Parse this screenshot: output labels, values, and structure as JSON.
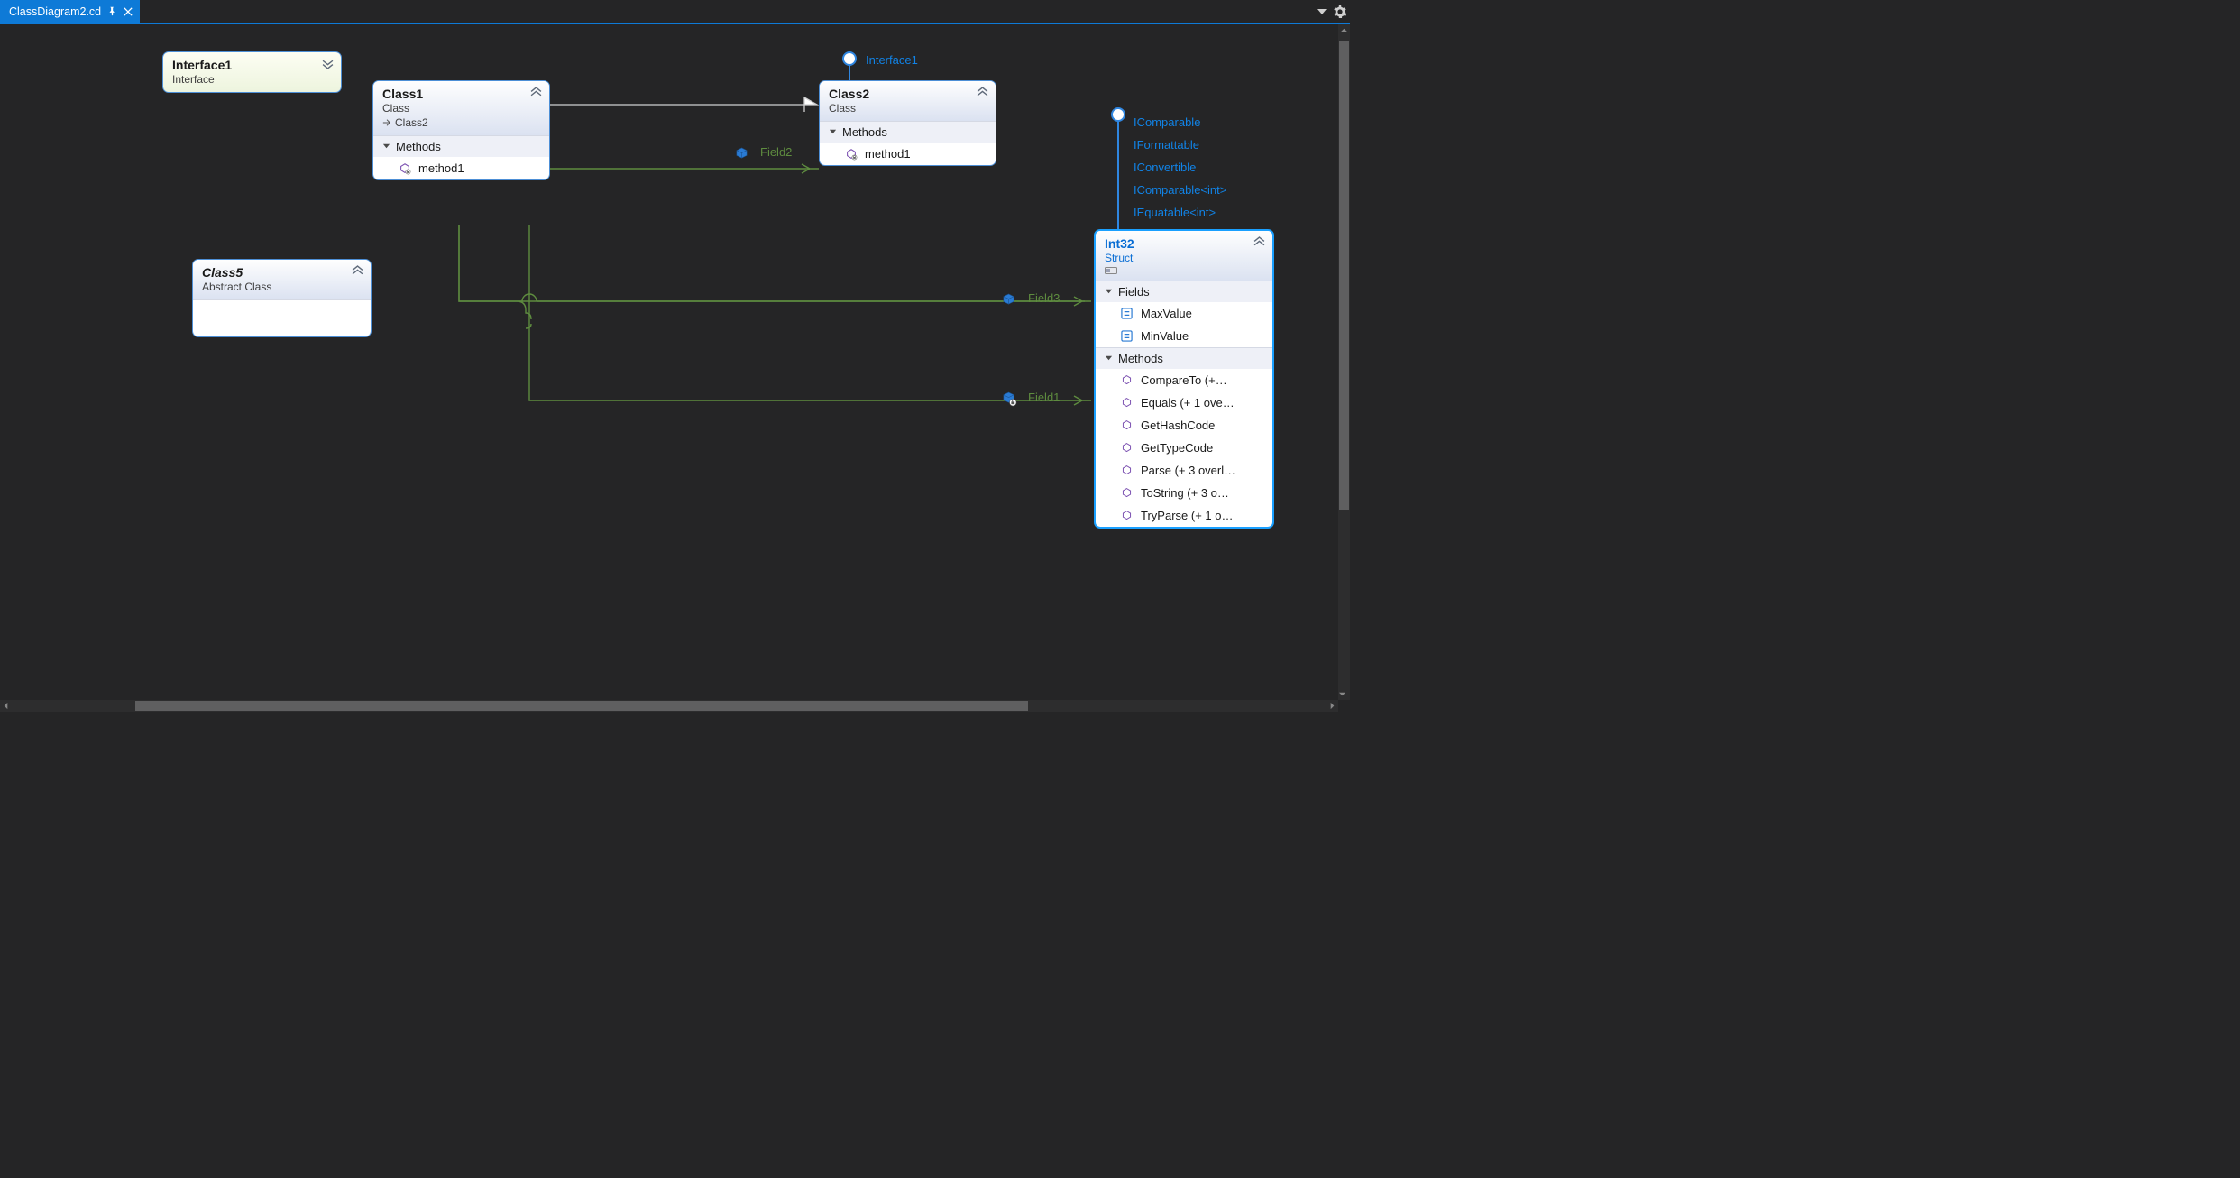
{
  "tab": {
    "title": "ClassDiagram2.cd"
  },
  "interface1": {
    "title": "Interface1",
    "subtitle": "Interface"
  },
  "class1": {
    "title": "Class1",
    "subtitle": "Class",
    "inherits": "Class2",
    "section": "Methods",
    "members": [
      "method1"
    ]
  },
  "class2": {
    "title": "Class2",
    "subtitle": "Class",
    "section": "Methods",
    "members": [
      "method1"
    ]
  },
  "class5": {
    "title": "Class5",
    "subtitle": "Abstract Class"
  },
  "int32": {
    "title": "Int32",
    "subtitle": "Struct",
    "implements": [
      "IComparable",
      "IFormattable",
      "IConvertible",
      "IComparable<int>",
      "IEquatable<int>"
    ],
    "sections": {
      "fields_label": "Fields",
      "fields": [
        "MaxValue",
        "MinValue"
      ],
      "methods_label": "Methods",
      "methods": [
        "CompareTo  (+…",
        "Equals  (+ 1 ove…",
        "GetHashCode",
        "GetTypeCode",
        "Parse  (+ 3 overl…",
        "ToString  (+ 3 o…",
        "TryParse  (+ 1 o…"
      ]
    }
  },
  "lollipops": {
    "class2_interface": "Interface1"
  },
  "associations": {
    "field2": "Field2",
    "field3": "Field3",
    "field1": "Field1"
  }
}
